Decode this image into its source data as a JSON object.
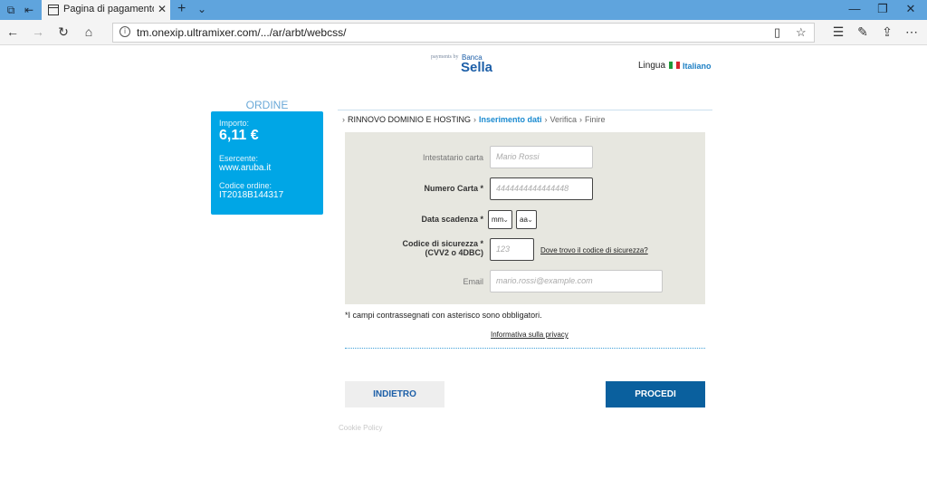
{
  "browser": {
    "tab_title": "Pagina di pagamento C",
    "tab_close": "✕",
    "new_tab": "+",
    "tab_menu": "⌄",
    "url": "tm.onexip.ultramixer.com/.../ar/arbt/webcss/",
    "window_controls": [
      "—",
      "❐",
      "✕"
    ]
  },
  "header": {
    "logo_small": "payments by",
    "logo_banca": "Banca",
    "logo_sella": "Sella",
    "lingua_label": "Lingua",
    "lingua_value": "Italiano",
    "flag_colors": [
      "#1f9a3a",
      "#ffffff",
      "#d8262e"
    ]
  },
  "order": {
    "title": "ORDINE",
    "amount_label": "Importo:",
    "amount": "6,11 €",
    "merchant_label": "Esercente:",
    "merchant": "www.aruba.it",
    "code_label": "Codice ordine:",
    "code": "IT2018B144317"
  },
  "steps": {
    "step1": "RINNOVO DOMINIO E HOSTING",
    "step2": "Inserimento dati",
    "step3": "Verifica",
    "step4": "Finire"
  },
  "form": {
    "holder_label": "Intestatario carta",
    "holder_placeholder": "Mario Rossi",
    "number_label": "Numero Carta *",
    "number_placeholder": "4444444444444448",
    "expiry_label": "Data scadenza *",
    "month_value": "mm",
    "year_value": "aa",
    "cvv_label_line1": "Codice di sicurezza *",
    "cvv_label_line2": "(CVV2 o 4DBC)",
    "cvv_placeholder": "123",
    "cvv_help": "Dove trovo il codice di sicurezza?",
    "email_label": "Email",
    "email_placeholder": "mario.rossi@example.com"
  },
  "footer": {
    "note": "*I campi contrassegnati con asterisco sono obbligatori.",
    "privacy": "Informativa sulla privacy",
    "back_button": "INDIETRO",
    "proceed_button": "PROCEDI",
    "cookie": "Cookie Policy"
  },
  "colors": {
    "order_box": "#00a6e6",
    "proceed_button": "#0a609e",
    "active_step": "#1a8ad0"
  }
}
